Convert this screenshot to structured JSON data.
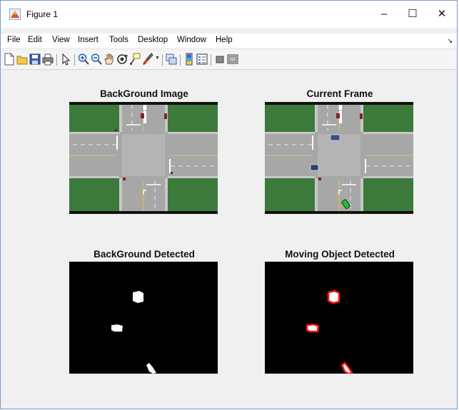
{
  "window": {
    "title": "Figure 1",
    "minimize_glyph": "–",
    "maximize_glyph": "☐",
    "close_glyph": "✕"
  },
  "menu": [
    {
      "label": "File"
    },
    {
      "label": "Edit"
    },
    {
      "label": "View"
    },
    {
      "label": "Insert"
    },
    {
      "label": "Tools"
    },
    {
      "label": "Desktop"
    },
    {
      "label": "Window"
    },
    {
      "label": "Help"
    }
  ],
  "toolbar": {
    "icons": [
      "new-figure-icon",
      "open-file-icon",
      "save-icon",
      "print-icon",
      "edit-plot-arrow-icon",
      "zoom-in-icon",
      "zoom-out-icon",
      "pan-hand-icon",
      "rotate-3d-icon",
      "data-cursor-icon",
      "brush-icon",
      "brush-dropdown-icon",
      "link-plot-icon",
      "insert-colorbar-icon",
      "insert-legend-icon",
      "hide-plot-tools-icon",
      "show-plot-tools-icon"
    ]
  },
  "panels": [
    {
      "title": "BackGround Image"
    },
    {
      "title": "Current Frame"
    },
    {
      "title": "BackGround Detected"
    },
    {
      "title": "Moving Object Detected"
    }
  ]
}
